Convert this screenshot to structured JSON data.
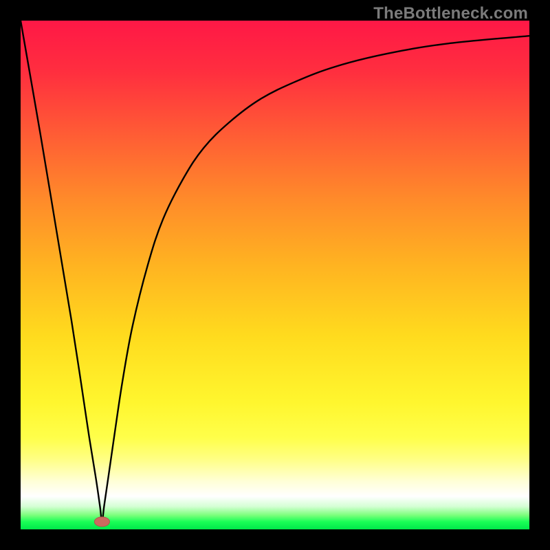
{
  "watermark": "TheBottleneck.com",
  "gradient": {
    "stops": [
      {
        "offset": 0.0,
        "color": "#ff1846"
      },
      {
        "offset": 0.1,
        "color": "#ff2e3f"
      },
      {
        "offset": 0.22,
        "color": "#ff5b35"
      },
      {
        "offset": 0.35,
        "color": "#ff8a2a"
      },
      {
        "offset": 0.48,
        "color": "#ffb321"
      },
      {
        "offset": 0.62,
        "color": "#ffdb1e"
      },
      {
        "offset": 0.75,
        "color": "#fff62e"
      },
      {
        "offset": 0.82,
        "color": "#ffff4a"
      },
      {
        "offset": 0.86,
        "color": "#ffff81"
      },
      {
        "offset": 0.905,
        "color": "#ffffd6"
      },
      {
        "offset": 0.935,
        "color": "#ffffff"
      },
      {
        "offset": 0.955,
        "color": "#d4ffd4"
      },
      {
        "offset": 0.972,
        "color": "#7cff7c"
      },
      {
        "offset": 0.985,
        "color": "#1aff56"
      },
      {
        "offset": 1.0,
        "color": "#00e84a"
      }
    ]
  },
  "marker": {
    "cx_pct": 0.16,
    "cy_pct": 0.985,
    "color": "#cc6a5f",
    "rx": 11,
    "ry": 7
  },
  "chart_data": {
    "type": "line",
    "title": "",
    "xlabel": "",
    "ylabel": "",
    "xlim": [
      0,
      100
    ],
    "ylim": [
      0,
      100
    ],
    "note": "Bottleneck-style curve: steep V dip near x≈16 reaching y≈0, rising asymptotically toward y≈100.",
    "series": [
      {
        "name": "curve",
        "x": [
          0,
          4,
          7,
          10,
          12,
          13.5,
          14.8,
          15.6,
          16,
          16.4,
          17.2,
          18.5,
          20,
          22,
          25,
          28,
          32,
          36,
          41,
          47,
          54,
          62,
          72,
          84,
          100
        ],
        "y": [
          100,
          77,
          59,
          41,
          28,
          18,
          10,
          4.5,
          1.5,
          4.5,
          10,
          19,
          29,
          40,
          52,
          61,
          69,
          75,
          80,
          84.5,
          88,
          91,
          93.5,
          95.5,
          97
        ]
      }
    ],
    "marker_point": {
      "x": 16,
      "y": 1.5
    }
  }
}
